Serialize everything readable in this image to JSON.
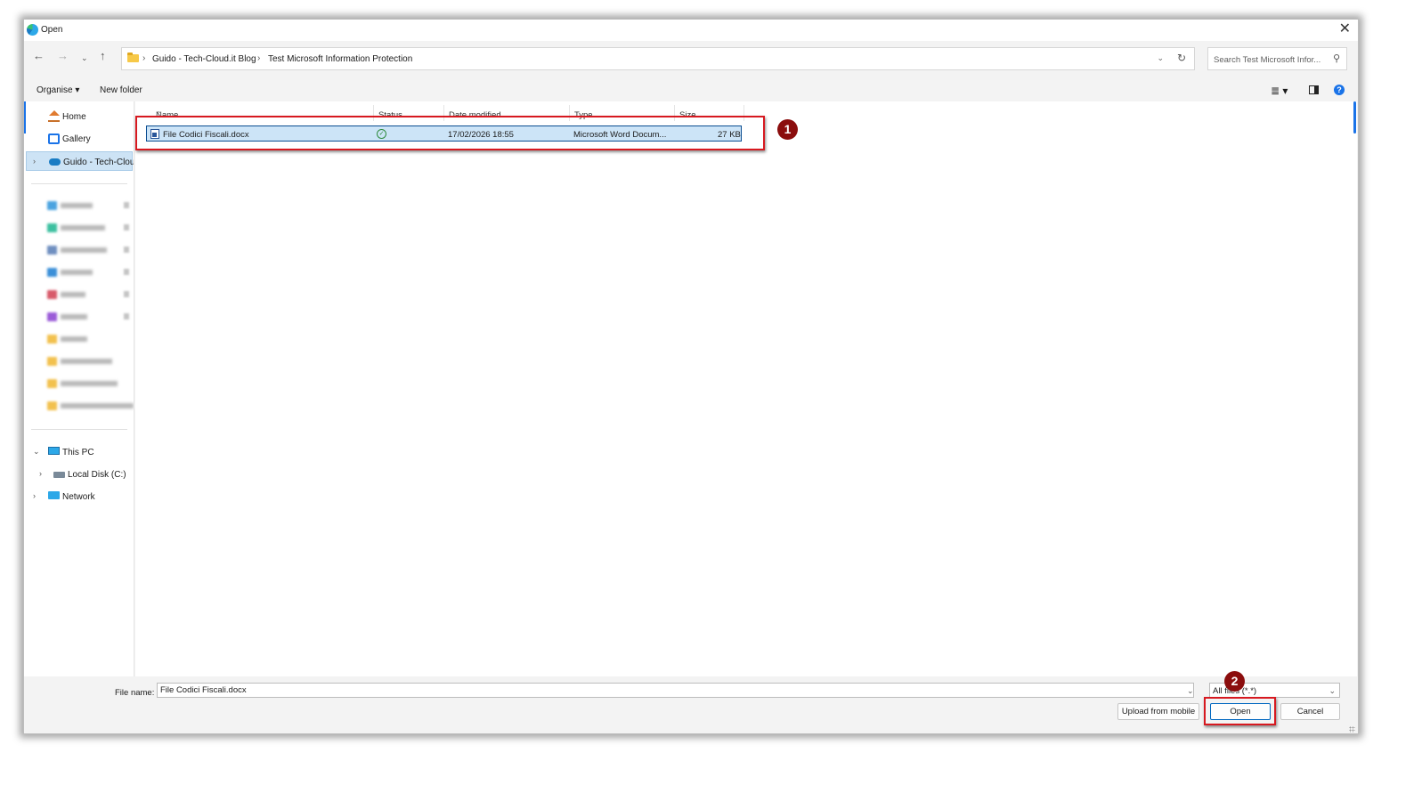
{
  "window": {
    "title": "Open",
    "close_glyph": "✕"
  },
  "address": {
    "crumbs": [
      "Guido - Tech-Cloud.it Blog",
      "Test Microsoft Information Protection"
    ],
    "separator": "›"
  },
  "search": {
    "placeholder": "Search Test Microsoft Infor..."
  },
  "toolbar": {
    "organise": "Organise ▾",
    "new_folder": "New folder"
  },
  "sidebar": {
    "home": "Home",
    "gallery": "Gallery",
    "onedrive": "Guido - Tech-Cloud.it Blog",
    "this_pc": "This PC",
    "local_disk": "Local Disk (C:)",
    "network": "Network"
  },
  "columns": {
    "name": "Name",
    "status": "Status",
    "date": "Date modified",
    "type": "Type",
    "size": "Size"
  },
  "files": [
    {
      "name": "File Codici Fiscali.docx",
      "status": "✓",
      "date": "17/02/2026 18:55",
      "type": "Microsoft Word Docum...",
      "size": "27 KB"
    }
  ],
  "bottom": {
    "file_name_label": "File name:",
    "file_name_value": "File Codici Fiscali.docx",
    "file_type": "All files (*.*)",
    "upload": "Upload from mobile",
    "open": "Open",
    "cancel": "Cancel"
  },
  "callouts": [
    "1",
    "2"
  ],
  "colors": {
    "accent": "#1a73e8",
    "selection": "#cce4f7",
    "callout_border": "#d71920",
    "callout_badge": "#8b0d0d"
  },
  "icons": [
    "app-icon",
    "back-arrow-icon",
    "forward-arrow-icon",
    "recent-chevron-icon",
    "up-arrow-icon",
    "folder-icon",
    "chevron-down-icon",
    "refresh-icon",
    "search-icon",
    "view-list-icon",
    "details-pane-icon",
    "help-icon",
    "home-icon",
    "gallery-icon",
    "cloud-icon",
    "pc-icon",
    "disk-icon",
    "network-icon",
    "word-doc-icon",
    "sync-ok-icon"
  ]
}
